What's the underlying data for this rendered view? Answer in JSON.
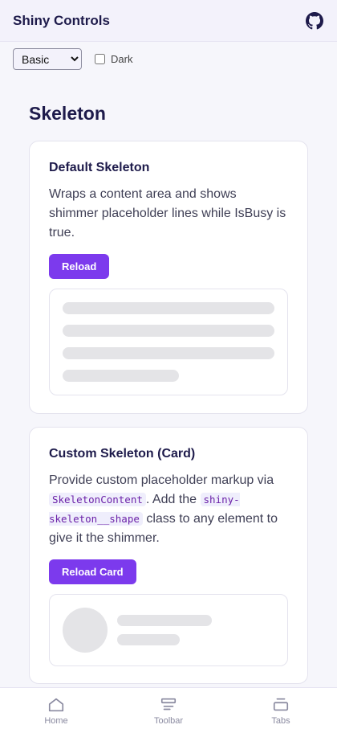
{
  "header": {
    "title": "Shiny Controls",
    "github_icon": "github-icon"
  },
  "controls": {
    "theme_options": [
      "Basic"
    ],
    "theme_selected": "Basic",
    "dark_label": "Dark",
    "dark_checked": false
  },
  "page": {
    "title": "Skeleton"
  },
  "cards": [
    {
      "title": "Default Skeleton",
      "description": "Wraps a content area and shows shimmer placeholder lines while IsBusy is true.",
      "button_label": "Reload",
      "skeleton_lines": [
        1.0,
        1.0,
        1.0,
        0.55
      ]
    },
    {
      "title": "Custom Skeleton (Card)",
      "desc_part1": "Provide custom placeholder markup via ",
      "desc_code1": "SkeletonContent",
      "desc_part2": ". Add the ",
      "desc_code2": "shiny-skeleton__shape",
      "desc_part3": " class to any element to give it the shimmer.",
      "button_label": "Reload Card"
    }
  ],
  "bottom_nav": {
    "items": [
      {
        "label": "Home",
        "icon": "home-icon"
      },
      {
        "label": "Toolbar",
        "icon": "toolbar-icon"
      },
      {
        "label": "Tabs",
        "icon": "tabs-icon"
      }
    ]
  },
  "colors": {
    "accent": "#7c3aed",
    "title_text": "#1e1b4b",
    "skeleton": "#e4e4e7",
    "header_bg": "#f3f2fb"
  }
}
